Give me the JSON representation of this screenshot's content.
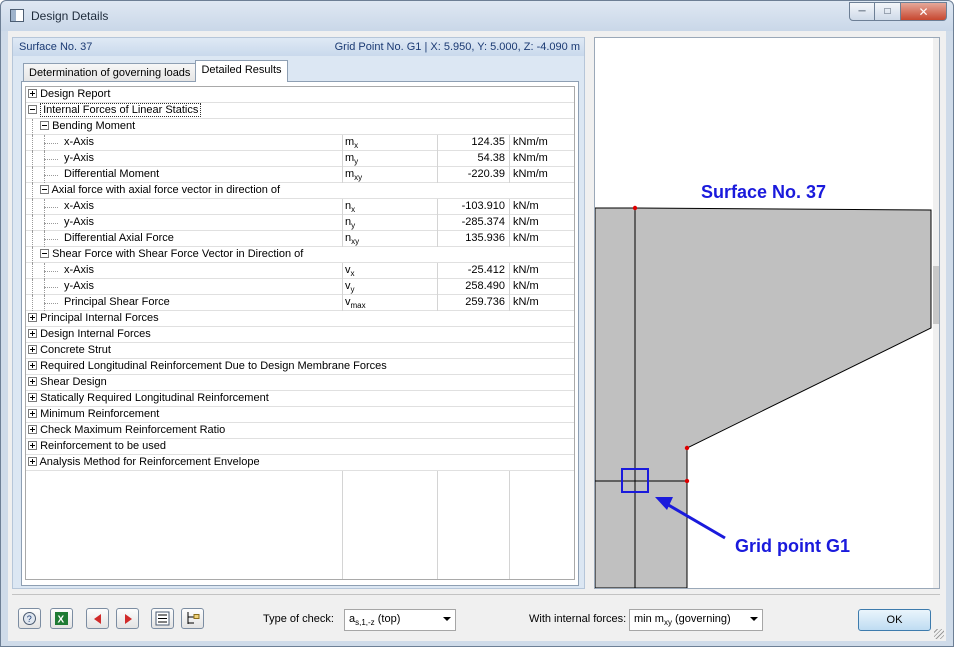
{
  "window": {
    "title": "Design Details"
  },
  "header": {
    "surface": "Surface No. 37",
    "grid_point": "Grid Point No. G1  |  X: 5.950, Y: 5.000, Z: -4.090 m"
  },
  "tabs": [
    {
      "label": "Determination of governing loads"
    },
    {
      "label": "Detailed Results"
    }
  ],
  "rows": [
    {
      "type": "group",
      "expanded": false,
      "label": "Design Report"
    },
    {
      "type": "group",
      "expanded": true,
      "label": "Internal Forces of Linear Statics"
    },
    {
      "type": "subgroup",
      "label": "Bending Moment"
    },
    {
      "type": "data",
      "label": "x-Axis",
      "sym": "m",
      "sub": "x",
      "value": "124.35",
      "unit": "kNm/m"
    },
    {
      "type": "data",
      "label": "y-Axis",
      "sym": "m",
      "sub": "y",
      "value": "54.38",
      "unit": "kNm/m"
    },
    {
      "type": "data",
      "label": "Differential Moment",
      "sym": "m",
      "sub": "xy",
      "value": "-220.39",
      "unit": "kNm/m"
    },
    {
      "type": "subgroup",
      "label": "Axial force with axial force vector in direction of"
    },
    {
      "type": "data",
      "label": "x-Axis",
      "sym": "n",
      "sub": "x",
      "value": "-103.910",
      "unit": "kN/m"
    },
    {
      "type": "data",
      "label": "y-Axis",
      "sym": "n",
      "sub": "y",
      "value": "-285.374",
      "unit": "kN/m"
    },
    {
      "type": "data",
      "label": "Differential Axial Force",
      "sym": "n",
      "sub": "xy",
      "value": "135.936",
      "unit": "kN/m"
    },
    {
      "type": "subgroup",
      "label": "Shear Force with Shear Force Vector in Direction of"
    },
    {
      "type": "data",
      "label": "x-Axis",
      "sym": "v",
      "sub": "x",
      "value": "-25.412",
      "unit": "kN/m"
    },
    {
      "type": "data",
      "label": "y-Axis",
      "sym": "v",
      "sub": "y",
      "value": "258.490",
      "unit": "kN/m"
    },
    {
      "type": "data",
      "label": "Principal Shear Force",
      "sym": "v",
      "sub": "max",
      "value": "259.736",
      "unit": "kN/m"
    },
    {
      "type": "group",
      "expanded": false,
      "label": "Principal Internal Forces"
    },
    {
      "type": "group",
      "expanded": false,
      "label": "Design Internal Forces"
    },
    {
      "type": "group",
      "expanded": false,
      "label": "Concrete Strut"
    },
    {
      "type": "group",
      "expanded": false,
      "label": "Required Longitudinal Reinforcement Due to Design Membrane Forces"
    },
    {
      "type": "group",
      "expanded": false,
      "label": "Shear Design"
    },
    {
      "type": "group",
      "expanded": false,
      "label": "Statically Required Longitudinal Reinforcement"
    },
    {
      "type": "group",
      "expanded": false,
      "label": "Minimum Reinforcement"
    },
    {
      "type": "group",
      "expanded": false,
      "label": "Check Maximum Reinforcement Ratio"
    },
    {
      "type": "group",
      "expanded": false,
      "label": "Reinforcement to be used"
    },
    {
      "type": "group",
      "expanded": false,
      "label": "Analysis Method for Reinforcement Envelope"
    }
  ],
  "graphic": {
    "surface_label": "Surface No. 37",
    "grid_point_label": "Grid point G1",
    "label_color": "#1a1adc",
    "fill_color": "#c0c0c0"
  },
  "bottom": {
    "type_of_check_label": "Type of check:",
    "type_of_check_value": {
      "sym": "a",
      "sub": "s,1,-z",
      "rest": "(top)"
    },
    "internal_forces_label": "With internal forces:",
    "internal_forces_value": {
      "pre": "min m",
      "sub": "xy",
      "rest": "(governing)"
    },
    "ok_label": "OK"
  },
  "icons": [
    "help-icon",
    "excel-icon",
    "previous-icon",
    "next-icon",
    "list-icon",
    "tree-icon"
  ]
}
